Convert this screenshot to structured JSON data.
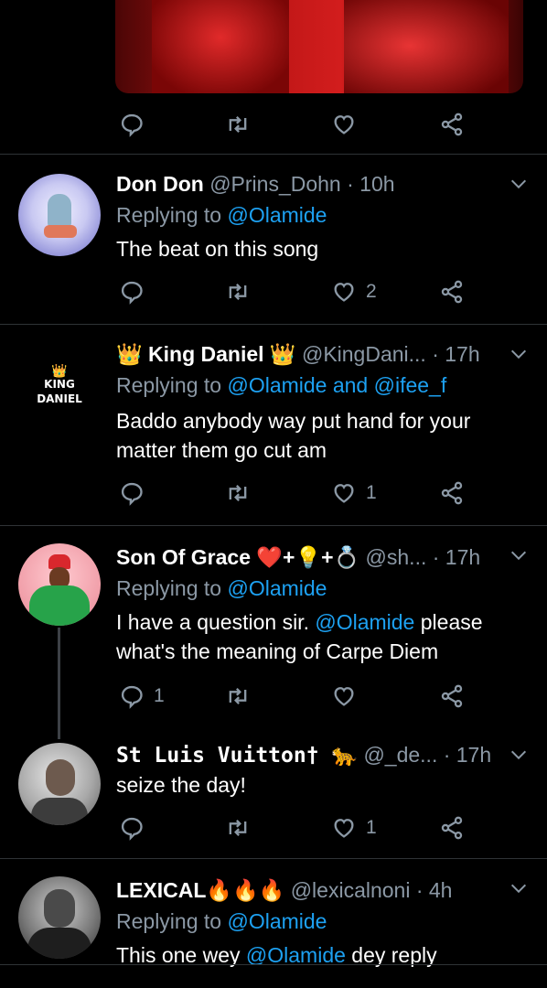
{
  "colors": {
    "background": "#000000",
    "text": "#ffffff",
    "muted": "#8b98a5",
    "link": "#1da1f2",
    "divider": "#2f3336"
  },
  "top_tweet": {
    "actions": {
      "reply_count": "",
      "retweet_count": "",
      "like_count": ""
    }
  },
  "tweets": [
    {
      "name": "Don Don",
      "handle": "@Prins_Dohn · 10h",
      "replying_prefix": "Replying to ",
      "replying_to": "@Olamide",
      "text": "The beat on this song",
      "reply_count": "",
      "retweet_count": "",
      "like_count": "2"
    },
    {
      "name": "👑 King Daniel 👑",
      "handle": "@KingDani... · 17h",
      "replying_prefix": "Replying to ",
      "replying_to": "@Olamide and @ifee_f",
      "text": "Baddo anybody way put hand for your matter them go cut am",
      "reply_count": "",
      "retweet_count": "",
      "like_count": "1",
      "avatar_logo": {
        "crown": "👑",
        "line1": "KING",
        "line2": "DANIEL"
      }
    },
    {
      "name": "Son Of Grace ❤️+💡+💍",
      "handle": "@sh... · 17h",
      "replying_prefix": "Replying to ",
      "replying_to": "@Olamide",
      "text_part1": "I have a question sir. ",
      "text_mention": "@Olamide",
      "text_part2": " please what's the meaning of Carpe Diem",
      "reply_count": "1",
      "retweet_count": "",
      "like_count": ""
    },
    {
      "name": "St Luis Vuitton† 🐆",
      "handle": "@_de... · 17h",
      "text": "seize the day!",
      "reply_count": "",
      "retweet_count": "",
      "like_count": "1"
    },
    {
      "name": "LEXICAL🔥🔥🔥",
      "handle": "@lexicalnoni · 4h",
      "replying_prefix": "Replying to ",
      "replying_to": "@Olamide",
      "text_part1": "This one wey ",
      "text_mention": "@Olamide",
      "text_part2": " dey reply"
    }
  ],
  "icons": [
    "reply-icon",
    "retweet-icon",
    "like-icon",
    "share-icon",
    "chevron-down-icon"
  ]
}
